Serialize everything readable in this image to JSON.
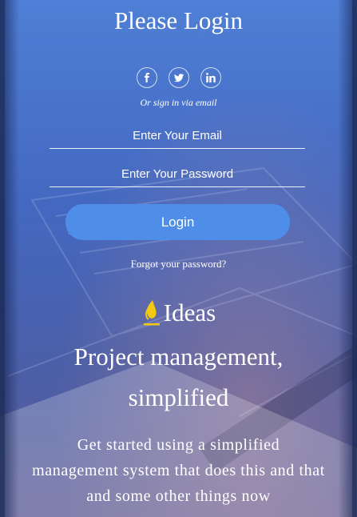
{
  "login": {
    "title": "Please Login",
    "social": [
      {
        "icon": "facebook-icon"
      },
      {
        "icon": "twitter-icon"
      },
      {
        "icon": "linkedin-icon"
      }
    ],
    "or_text": "Or sign in via email",
    "email_placeholder": "Enter Your Email",
    "password_placeholder": "Enter Your Password",
    "login_label": "Login",
    "forgot_label": "Forgot your password?"
  },
  "brand": {
    "name": "Ideas",
    "headline": "Project management, simplified",
    "description": "Get started using a simplified management system that does this and that and some other things now"
  },
  "colors": {
    "background_top": "#4f7fd6",
    "background_bottom": "#5e5d96",
    "login_button": "#4e8de8",
    "logo_accent": "#f2c811",
    "text": "#ffffff"
  }
}
